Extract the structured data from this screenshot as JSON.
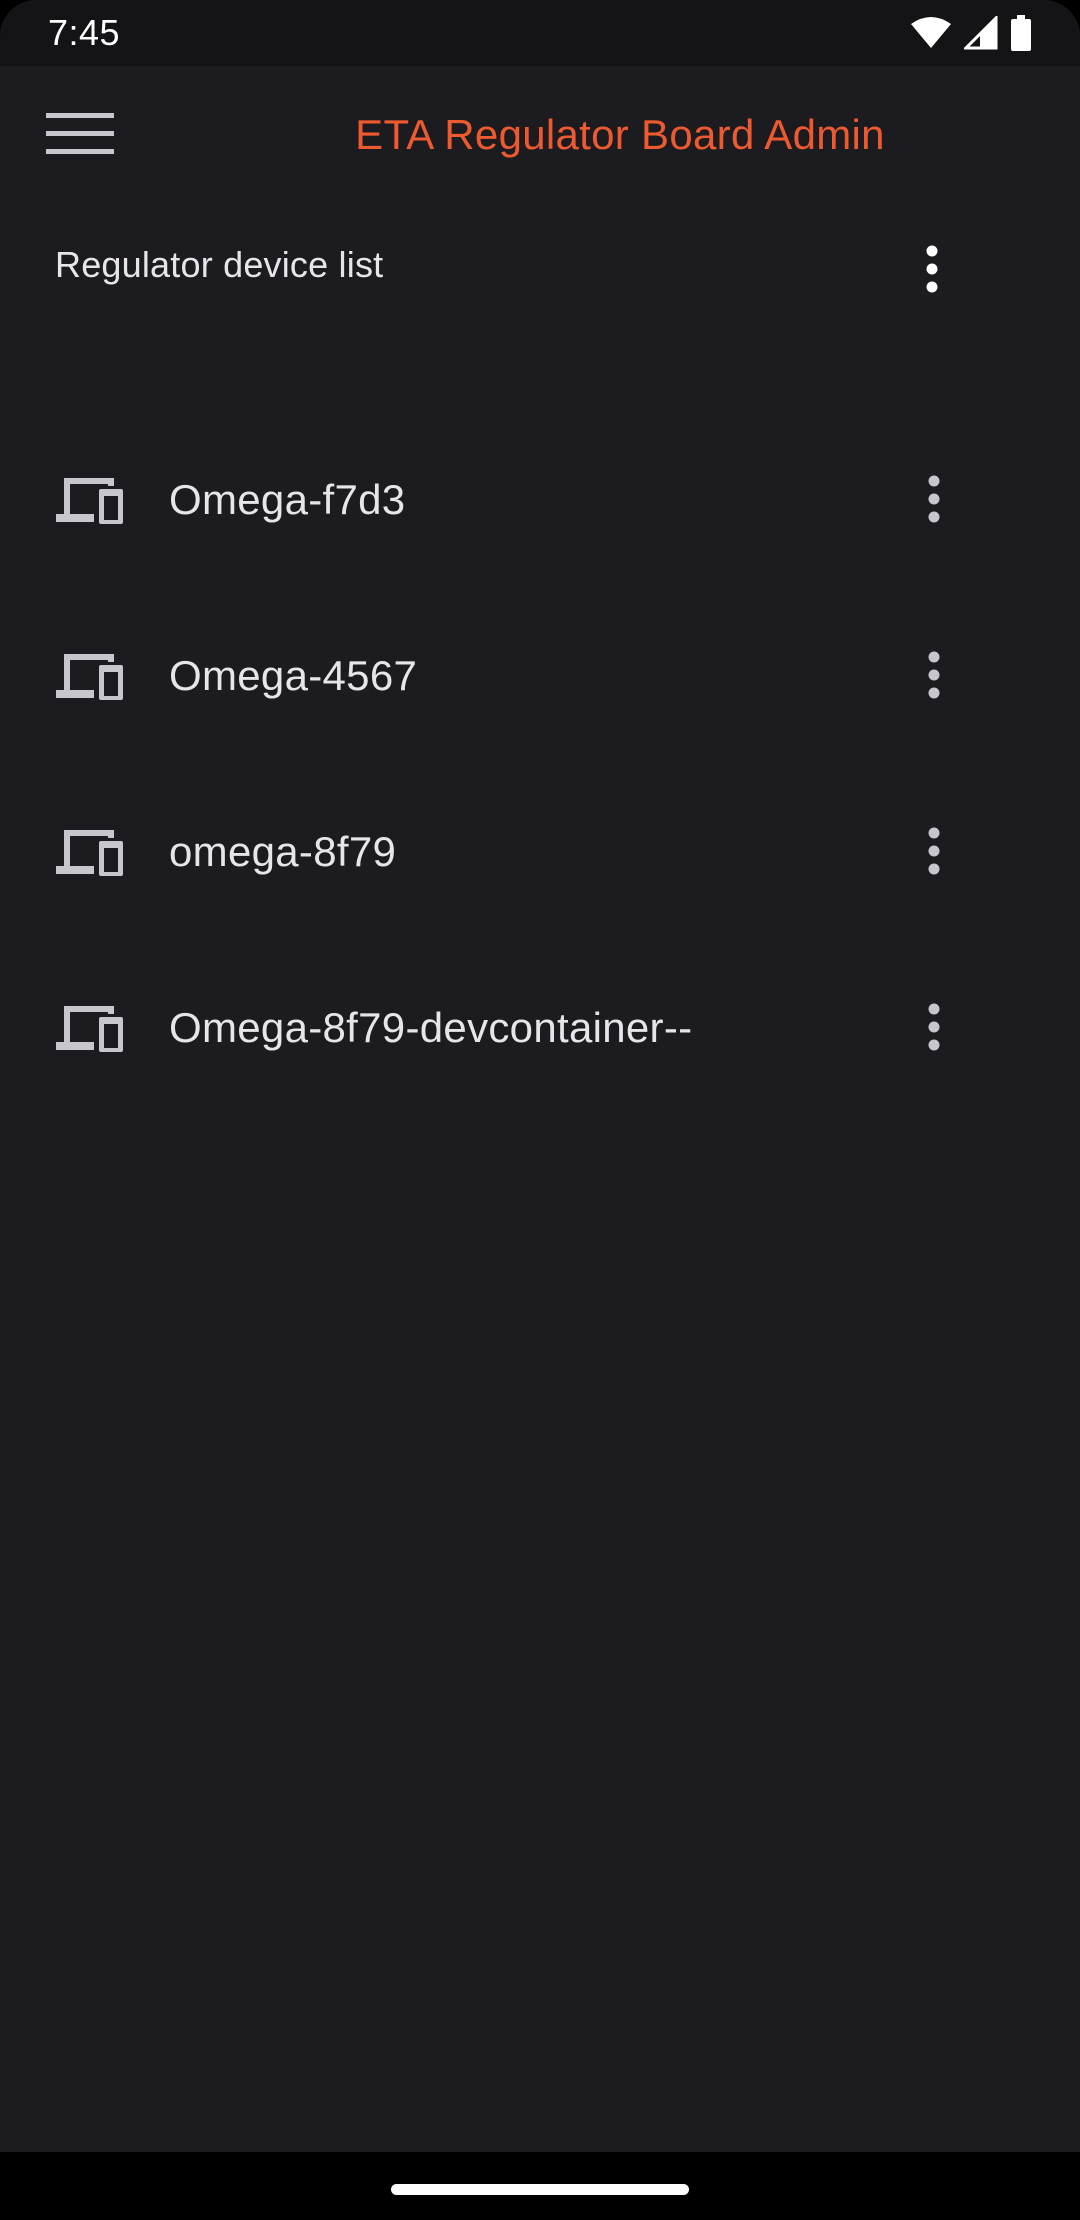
{
  "status_bar": {
    "time": "7:45",
    "icons": [
      "wifi-icon",
      "cellular-signal-icon",
      "battery-icon"
    ]
  },
  "app_bar": {
    "title": "ETA Regulator Board Admin",
    "menu_icon": "hamburger-menu-icon",
    "title_color": "#ee5a2f"
  },
  "section": {
    "title": "Regulator device list",
    "more_icon": "more-vert-icon"
  },
  "devices": [
    {
      "label": "Omega-f7d3",
      "icon": "devices-icon"
    },
    {
      "label": "Omega-4567",
      "icon": "devices-icon"
    },
    {
      "label": "omega-8f79",
      "icon": "devices-icon"
    },
    {
      "label": "Omega-8f79-devcontainer--",
      "icon": "devices-icon"
    }
  ],
  "colors": {
    "background": "#1c1b20",
    "status_bar": "#141316",
    "accent": "#ee5a2f",
    "text": "#e7e5ea",
    "icon": "#c8c6cd"
  }
}
